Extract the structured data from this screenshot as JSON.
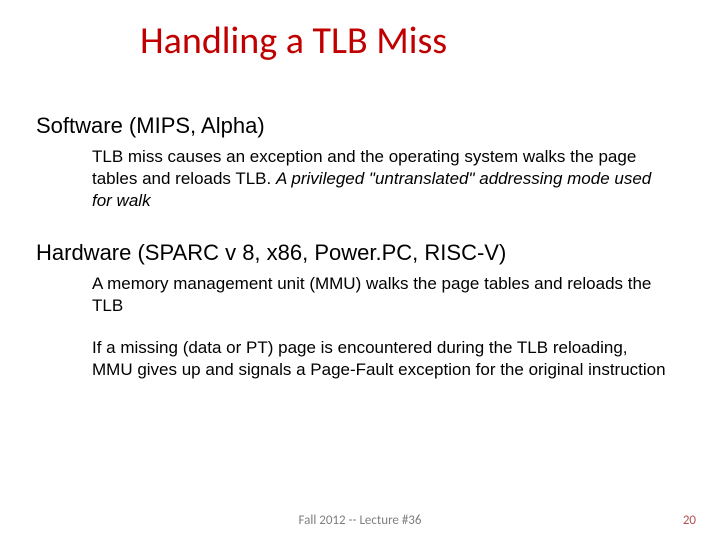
{
  "title": "Handling a TLB Miss",
  "sections": {
    "software": {
      "heading": "Software (MIPS, Alpha)",
      "body_plain": "TLB miss causes an exception and the operating system walks the page tables and reloads TLB. ",
      "body_italic": "A privileged \"untranslated\" addressing mode used for walk"
    },
    "hardware": {
      "heading": "Hardware (SPARC v 8, x86, Power.PC, RISC-V)",
      "body1": "A memory management unit (MMU) walks the page tables and reloads the TLB",
      "body2": "If a missing (data or PT) page is encountered during the TLB reloading, MMU gives up and signals a Page-Fault exception for the original instruction"
    }
  },
  "footer": {
    "center": "Fall 2012 -- Lecture #36",
    "page": "20"
  }
}
